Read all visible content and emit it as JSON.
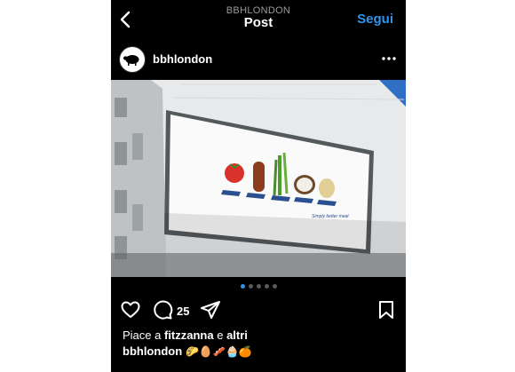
{
  "topbar": {
    "account": "BBHLONDON",
    "title": "Post",
    "follow_label": "Segui"
  },
  "post": {
    "username": "bbhlondon",
    "billboard_text": "Simply better meat",
    "carousel": {
      "count": 5,
      "active_index": 0
    },
    "comments_count": "25",
    "likes": {
      "prefix": "Piace a ",
      "user": "fitzzanna",
      "middle": " e ",
      "others": "altri"
    },
    "caption": {
      "username": "bbhlondon",
      "emojis": "🌮🥚🥓🧁🍊"
    }
  },
  "icons": [
    "back-icon",
    "sheep-logo-icon",
    "more-icon",
    "heart-icon",
    "comment-icon",
    "share-icon",
    "bookmark-icon"
  ],
  "colors": {
    "background": "#000000",
    "accent": "#2f93ea",
    "muted": "#9a9a9a"
  }
}
